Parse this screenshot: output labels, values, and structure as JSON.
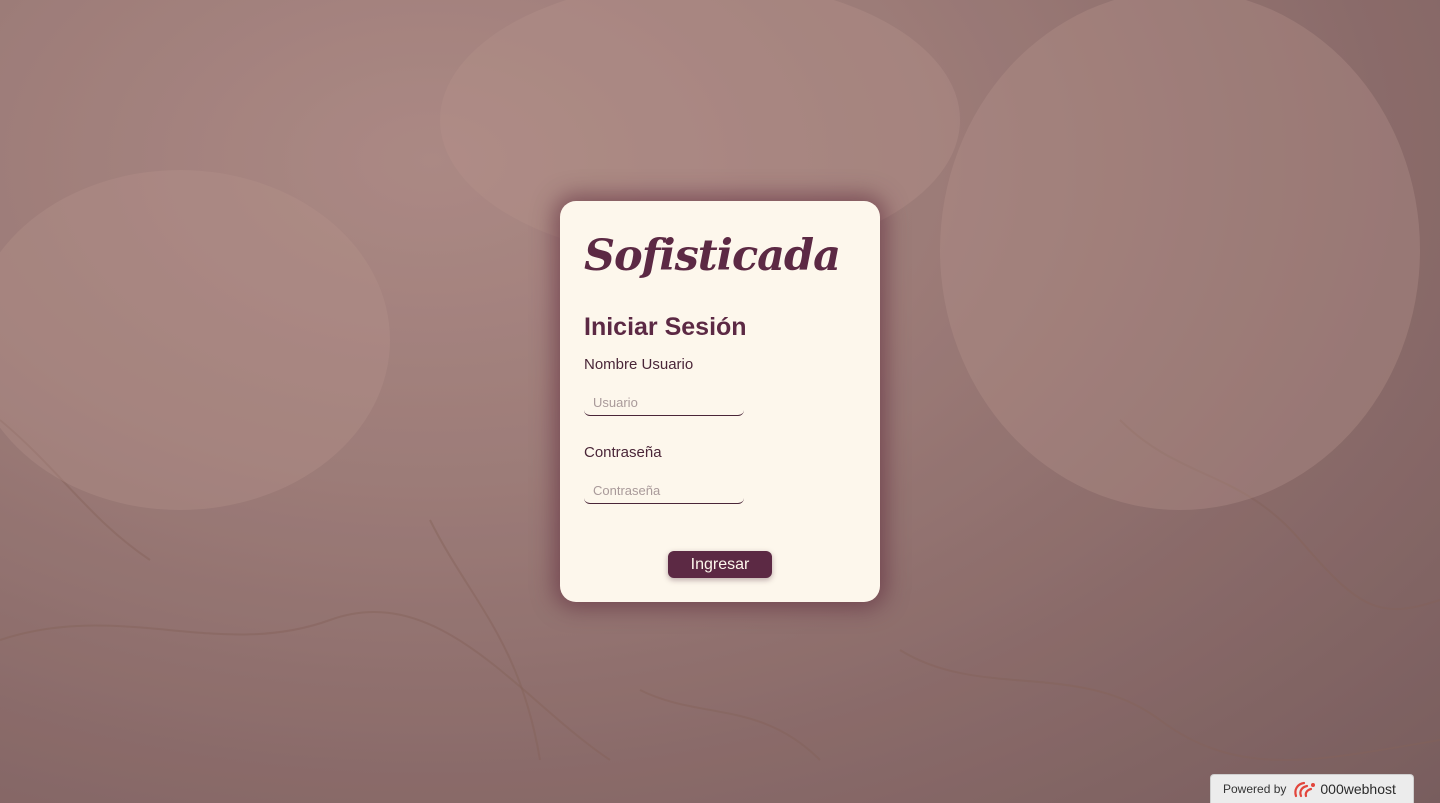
{
  "app": {
    "brand": "Sofisticada"
  },
  "login": {
    "heading": "Iniciar Sesión",
    "username_label": "Nombre Usuario",
    "username_placeholder": "Usuario",
    "username_value": "",
    "password_label": "Contraseña",
    "password_placeholder": "Contraseña",
    "password_value": "",
    "submit_label": "Ingresar"
  },
  "footer": {
    "powered_by": "Powered by",
    "host_name": "000webhost",
    "logo_icon": "000webhost-logo-icon"
  },
  "colors": {
    "brand": "#5c2944",
    "card_background": "#fdf7ec",
    "text": "#4a2638"
  }
}
